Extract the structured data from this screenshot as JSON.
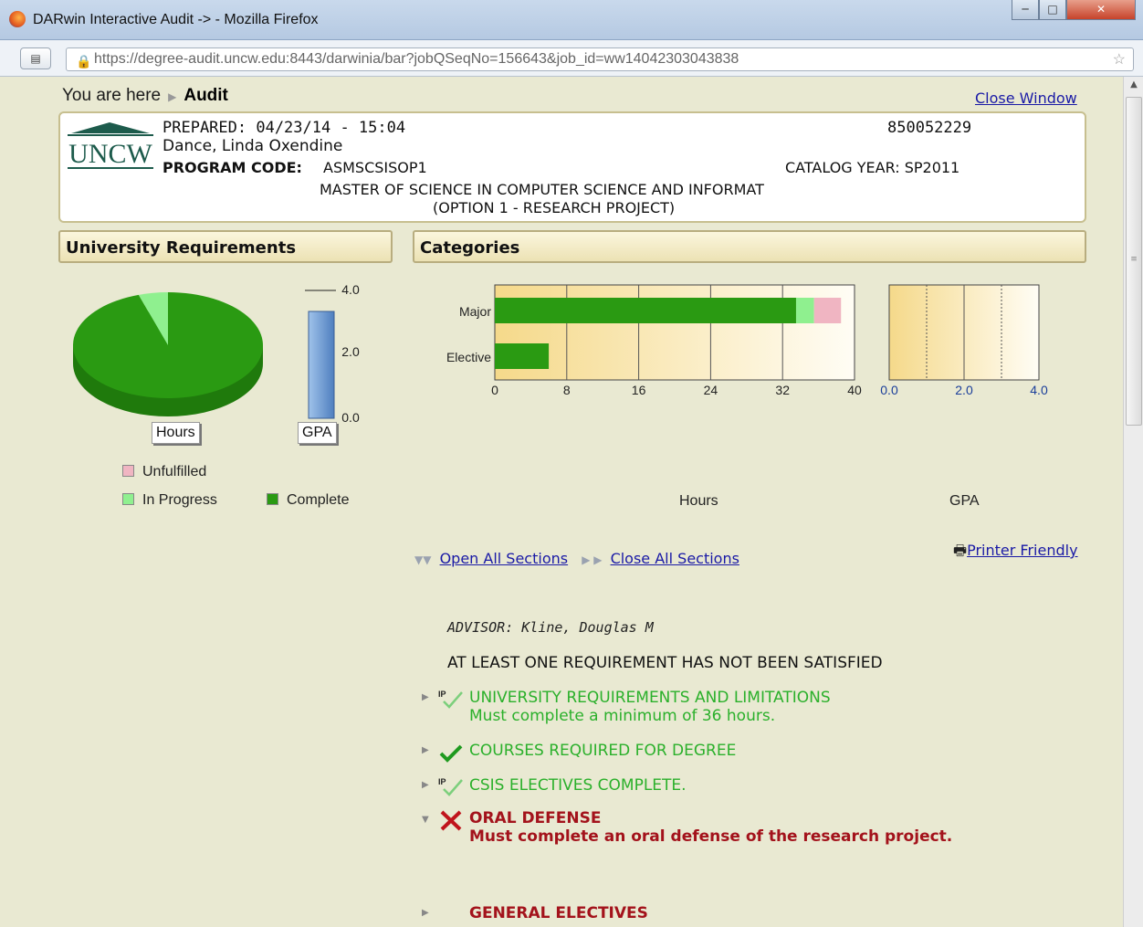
{
  "window": {
    "title": "DARwin Interactive Audit -> - Mozilla Firefox"
  },
  "browser": {
    "url": "https://degree-audit.uncw.edu:8443/darwinia/bar?jobQSeqNo=156643&job_id=ww14042303043838"
  },
  "nav": {
    "you_are_here": "You are here",
    "crumb": "Audit",
    "close_window": "Close Window"
  },
  "header": {
    "logo_text": "UNCW",
    "prepared": "PREPARED: 04/23/14 - 15:04",
    "student_id": "850052229",
    "name": "Dance, Linda Oxendine",
    "program_label": "PROGRAM CODE:",
    "program_code": "ASMSCSISOP1",
    "catalog": "CATALOG YEAR: SP2011",
    "degree": "MASTER OF SCIENCE IN COMPUTER SCIENCE AND INFORMAT",
    "option": "(OPTION 1 - RESEARCH PROJECT)"
  },
  "university_panel": {
    "title": "University Requirements",
    "hours_label": "Hours",
    "gpa_label": "GPA"
  },
  "categories_panel": {
    "title": "Categories",
    "hours_axis": "Hours",
    "gpa_axis": "GPA"
  },
  "legend": {
    "unfulfilled": "Unfulfilled",
    "in_progress": "In Progress",
    "complete": "Complete"
  },
  "colors": {
    "complete": "#2a9a12",
    "in_progress": "#8ff08f",
    "unfulfilled": "#f0b5c2",
    "gpa_bar": "#6f9bd3",
    "link": "#1a1aa6",
    "requirement_ok": "#2bb02b",
    "requirement_fail": "#a3121b"
  },
  "chart_data": [
    {
      "type": "pie",
      "xlabel": "Hours",
      "slices": [
        {
          "name": "Complete",
          "value": 95
        },
        {
          "name": "In Progress",
          "value": 5
        }
      ]
    },
    {
      "type": "bar",
      "xlabel": "GPA",
      "ticks": [
        "0.0",
        "2.0",
        "4.0"
      ],
      "ylim": [
        0,
        4
      ],
      "values": [
        3.6
      ]
    },
    {
      "type": "bar",
      "orientation": "horizontal",
      "xlabel": "Hours",
      "categories": [
        "Major",
        "Elective"
      ],
      "ticks": [
        "0",
        "8",
        "16",
        "24",
        "32",
        "40"
      ],
      "xlim": [
        0,
        40
      ],
      "series": [
        {
          "name": "Complete",
          "values": [
            33.5,
            6
          ]
        },
        {
          "name": "In Progress",
          "values": [
            2,
            0
          ]
        },
        {
          "name": "Unfulfilled",
          "values": [
            3,
            0
          ]
        }
      ]
    },
    {
      "type": "bar",
      "orientation": "horizontal",
      "xlabel": "GPA",
      "ticks": [
        "0.0",
        "2.0",
        "4.0"
      ],
      "xlim": [
        0,
        4
      ]
    }
  ],
  "sections": {
    "open_all": "Open All Sections",
    "close_all": "Close All Sections",
    "printer": "Printer Friendly"
  },
  "audit": {
    "advisor": "ADVISOR: Kline, Douglas M",
    "status": "AT LEAST ONE REQUIREMENT HAS NOT BEEN SATISFIED",
    "requirements": [
      {
        "title": "UNIVERSITY REQUIREMENTS AND LIMITATIONS",
        "sub": "Must complete a minimum of 36 hours.",
        "status": "in-progress"
      },
      {
        "title": "COURSES REQUIRED FOR DEGREE",
        "sub": "",
        "status": "complete"
      },
      {
        "title": "CSIS ELECTIVES COMPLETE.",
        "sub": "",
        "status": "in-progress"
      },
      {
        "title": "ORAL DEFENSE",
        "sub": "Must complete an oral defense of the research project.",
        "status": "not-complete"
      },
      {
        "title": "GENERAL ELECTIVES",
        "sub": "",
        "status": "not-complete"
      }
    ]
  }
}
